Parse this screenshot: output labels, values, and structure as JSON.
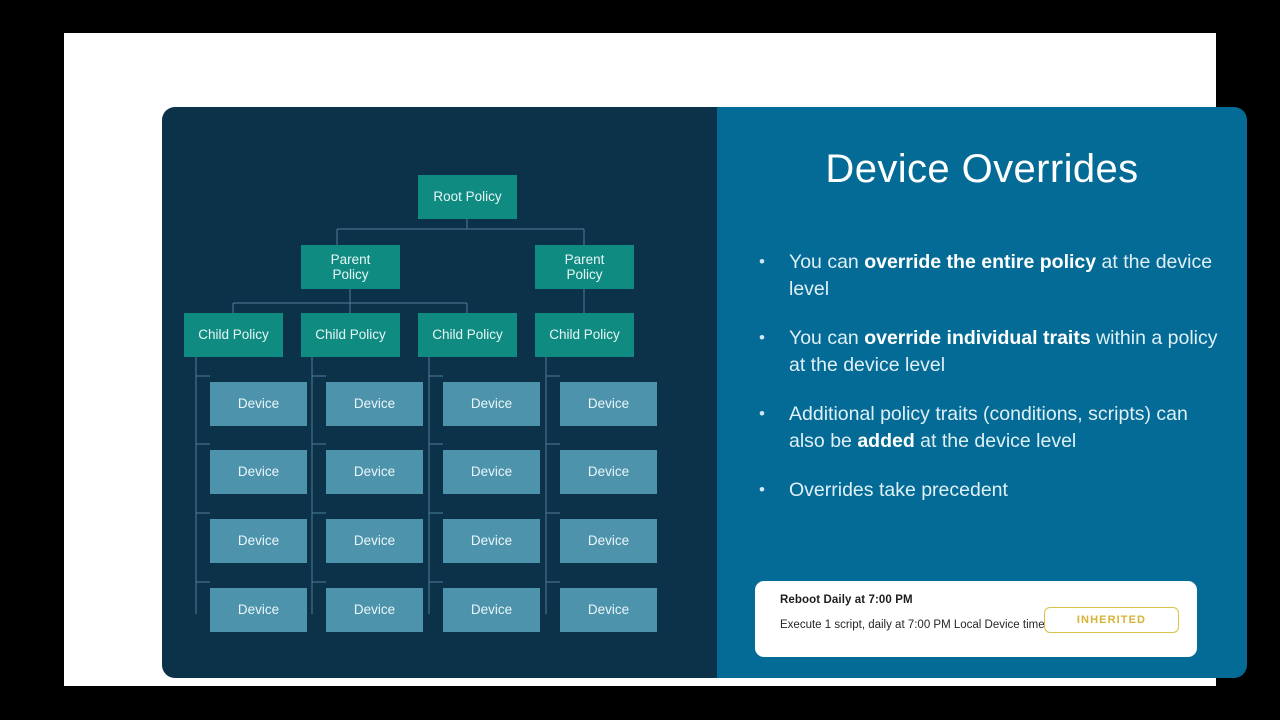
{
  "slide": {
    "title": "Device Overrides",
    "colors": {
      "left_panel": "#0b3249",
      "right_panel": "#036b96",
      "policy_box": "#0f8b82",
      "device_box": "#4d93ab",
      "badge_gold": "#d4b336",
      "connector": "#5c8ea3"
    }
  },
  "diagram": {
    "root": {
      "label": "Root Policy"
    },
    "parents": [
      {
        "label": "Parent\nPolicy",
        "line1": "Parent",
        "line2": "Policy"
      },
      {
        "label": "Parent\nPolicy",
        "line1": "Parent",
        "line2": "Policy"
      }
    ],
    "children": [
      {
        "label": "Child Policy"
      },
      {
        "label": "Child Policy"
      },
      {
        "label": "Child Policy"
      },
      {
        "label": "Child Policy"
      }
    ],
    "device_label": "Device",
    "devices_per_child": 4,
    "columns": 4
  },
  "bullets": [
    {
      "parts": [
        {
          "text": "You can ",
          "bold": false
        },
        {
          "text": "override the entire policy",
          "bold": true
        },
        {
          "text": " at the device level",
          "bold": false
        }
      ]
    },
    {
      "parts": [
        {
          "text": "You can ",
          "bold": false
        },
        {
          "text": "override individual traits",
          "bold": true
        },
        {
          "text": " within a policy at the device level",
          "bold": false
        }
      ]
    },
    {
      "parts": [
        {
          "text": "Additional policy traits (conditions, scripts) can also be ",
          "bold": false
        },
        {
          "text": "added",
          "bold": true
        },
        {
          "text": " at the device level",
          "bold": false
        }
      ]
    },
    {
      "parts": [
        {
          "text": "Overrides take precedent",
          "bold": false
        }
      ]
    }
  ],
  "bullet_marker": "•",
  "info_card": {
    "title": "Reboot Daily at 7:00 PM",
    "subtitle": "Execute 1 script, daily at 7:00 PM Local Device time",
    "badge": "INHERITED"
  }
}
